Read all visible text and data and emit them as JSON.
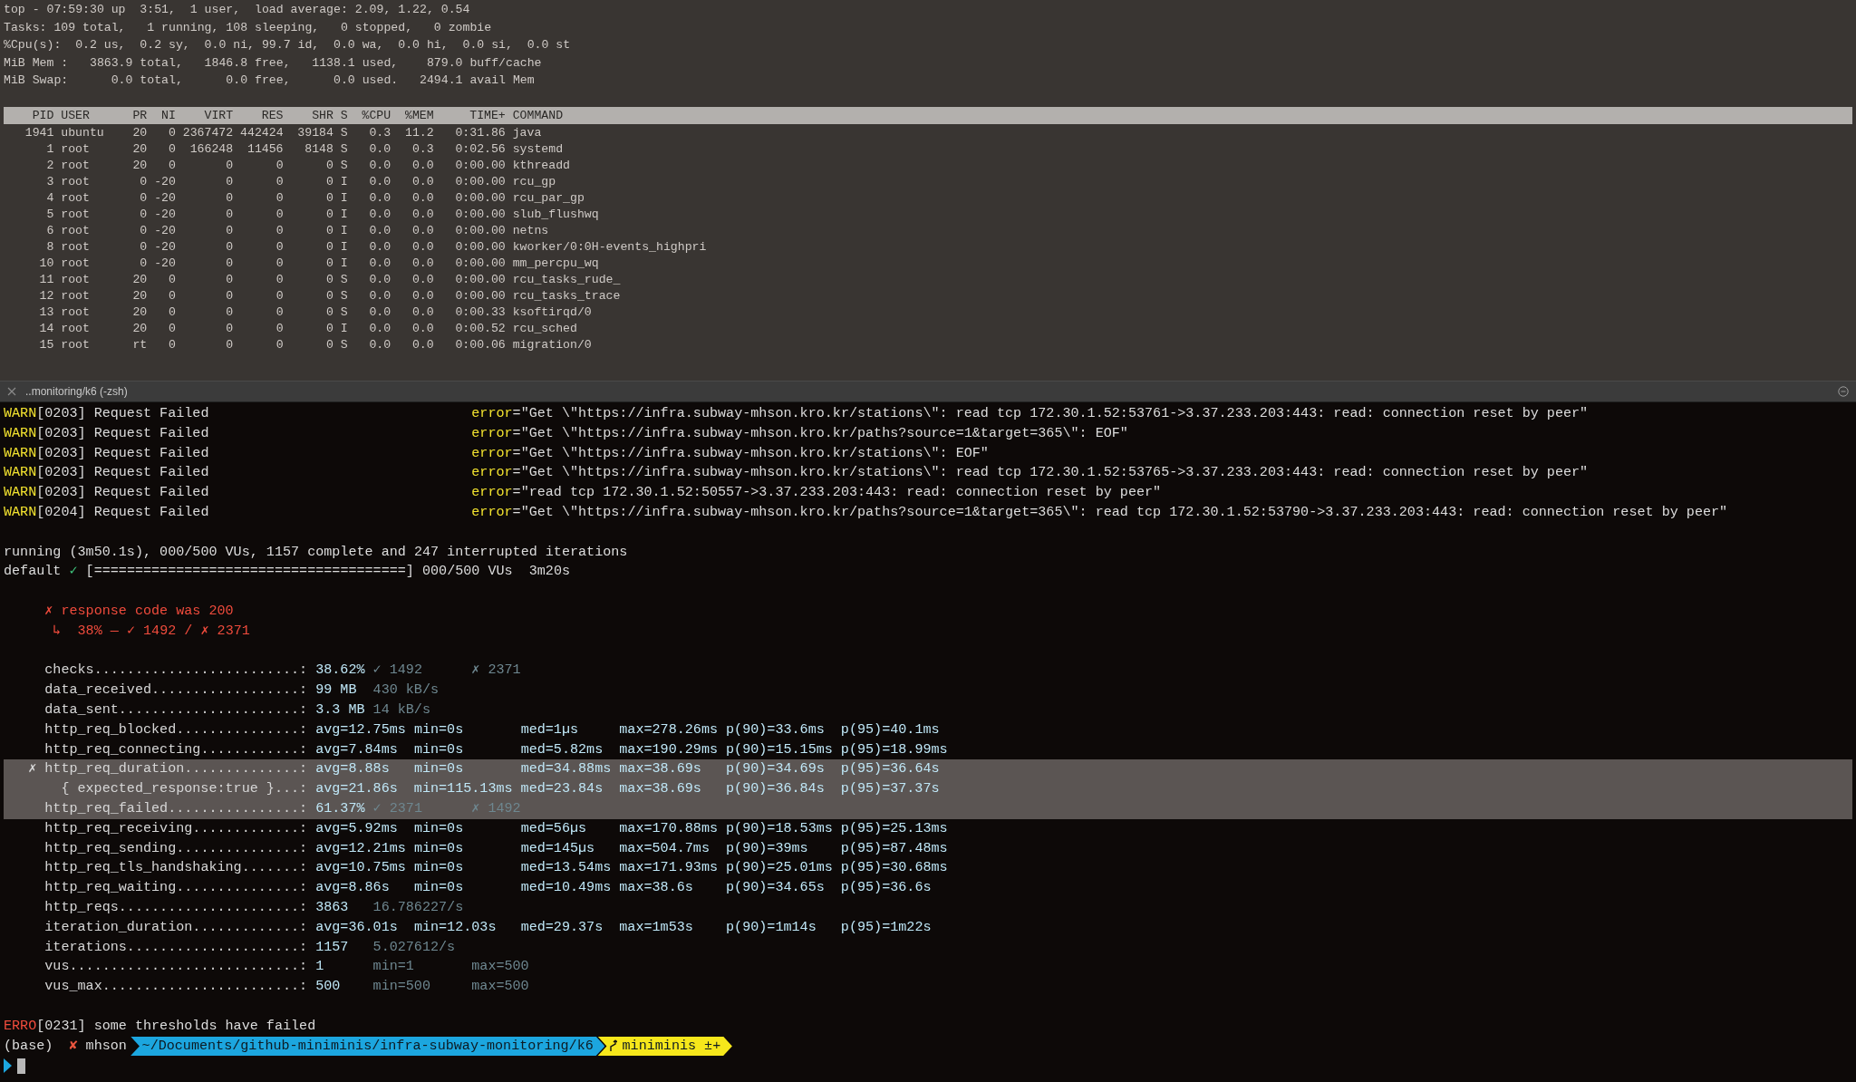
{
  "top": {
    "summary": [
      "top - 07:59:30 up  3:51,  1 user,  load average: 2.09, 1.22, 0.54",
      "Tasks: 109 total,   1 running, 108 sleeping,   0 stopped,   0 zombie",
      "%Cpu(s):  0.2 us,  0.2 sy,  0.0 ni, 99.7 id,  0.0 wa,  0.0 hi,  0.0 si,  0.0 st",
      "MiB Mem :   3863.9 total,   1846.8 free,   1138.1 used,    879.0 buff/cache",
      "MiB Swap:      0.0 total,      0.0 free,      0.0 used.   2494.1 avail Mem"
    ],
    "columns": [
      "PID",
      "USER",
      "PR",
      "NI",
      "VIRT",
      "RES",
      "SHR",
      "S",
      "%CPU",
      "%MEM",
      "TIME+",
      "COMMAND"
    ],
    "rows": [
      [
        "1941",
        "ubuntu",
        "20",
        "0",
        "2367472",
        "442424",
        "39184",
        "S",
        "0.3",
        "11.2",
        "0:31.86",
        "java"
      ],
      [
        "1",
        "root",
        "20",
        "0",
        "166248",
        "11456",
        "8148",
        "S",
        "0.0",
        "0.3",
        "0:02.56",
        "systemd"
      ],
      [
        "2",
        "root",
        "20",
        "0",
        "0",
        "0",
        "0",
        "S",
        "0.0",
        "0.0",
        "0:00.00",
        "kthreadd"
      ],
      [
        "3",
        "root",
        "0",
        "-20",
        "0",
        "0",
        "0",
        "I",
        "0.0",
        "0.0",
        "0:00.00",
        "rcu_gp"
      ],
      [
        "4",
        "root",
        "0",
        "-20",
        "0",
        "0",
        "0",
        "I",
        "0.0",
        "0.0",
        "0:00.00",
        "rcu_par_gp"
      ],
      [
        "5",
        "root",
        "0",
        "-20",
        "0",
        "0",
        "0",
        "I",
        "0.0",
        "0.0",
        "0:00.00",
        "slub_flushwq"
      ],
      [
        "6",
        "root",
        "0",
        "-20",
        "0",
        "0",
        "0",
        "I",
        "0.0",
        "0.0",
        "0:00.00",
        "netns"
      ],
      [
        "8",
        "root",
        "0",
        "-20",
        "0",
        "0",
        "0",
        "I",
        "0.0",
        "0.0",
        "0:00.00",
        "kworker/0:0H-events_highpri"
      ],
      [
        "10",
        "root",
        "0",
        "-20",
        "0",
        "0",
        "0",
        "I",
        "0.0",
        "0.0",
        "0:00.00",
        "mm_percpu_wq"
      ],
      [
        "11",
        "root",
        "20",
        "0",
        "0",
        "0",
        "0",
        "S",
        "0.0",
        "0.0",
        "0:00.00",
        "rcu_tasks_rude_"
      ],
      [
        "12",
        "root",
        "20",
        "0",
        "0",
        "0",
        "0",
        "S",
        "0.0",
        "0.0",
        "0:00.00",
        "rcu_tasks_trace"
      ],
      [
        "13",
        "root",
        "20",
        "0",
        "0",
        "0",
        "0",
        "S",
        "0.0",
        "0.0",
        "0:00.33",
        "ksoftirqd/0"
      ],
      [
        "14",
        "root",
        "20",
        "0",
        "0",
        "0",
        "0",
        "I",
        "0.0",
        "0.0",
        "0:00.52",
        "rcu_sched"
      ],
      [
        "15",
        "root",
        "rt",
        "0",
        "0",
        "0",
        "0",
        "S",
        "0.0",
        "0.0",
        "0:00.06",
        "migration/0"
      ]
    ]
  },
  "pane_tab": {
    "title": "..monitoring/k6 (-zsh)"
  },
  "logs": [
    {
      "kind": "warn",
      "level": "WARN",
      "message": "[0203] Request Failed",
      "field": "error",
      "value": "=\"Get \\\"https://infra.subway-mhson.kro.kr/stations\\\": read tcp 172.30.1.52:53761->3.37.233.203:443: read: connection reset by peer\""
    },
    {
      "kind": "warn",
      "level": "WARN",
      "message": "[0203] Request Failed",
      "field": "error",
      "value": "=\"Get \\\"https://infra.subway-mhson.kro.kr/paths?source=1&target=365\\\": EOF\""
    },
    {
      "kind": "warn",
      "level": "WARN",
      "message": "[0203] Request Failed",
      "field": "error",
      "value": "=\"Get \\\"https://infra.subway-mhson.kro.kr/stations\\\": EOF\""
    },
    {
      "kind": "warn",
      "level": "WARN",
      "message": "[0203] Request Failed",
      "field": "error",
      "value": "=\"Get \\\"https://infra.subway-mhson.kro.kr/stations\\\": read tcp 172.30.1.52:53765->3.37.233.203:443: read: connection reset by peer\""
    },
    {
      "kind": "warn",
      "level": "WARN",
      "message": "[0203] Request Failed",
      "field": "error",
      "value": "=\"read tcp 172.30.1.52:50557->3.37.233.203:443: read: connection reset by peer\""
    },
    {
      "kind": "warn",
      "level": "WARN",
      "message": "[0204] Request Failed",
      "field": "error",
      "value": "=\"Get \\\"https://infra.subway-mhson.kro.kr/paths?source=1&target=365\\\": read tcp 172.30.1.52:53790->3.37.233.203:443: read: connection reset by peer\""
    }
  ],
  "run_status": "running (3m50.1s), 000/500 VUs, 1157 complete and 247 interrupted iterations",
  "scenario": {
    "name": "default",
    "check": "✓",
    "bar": "[======================================]",
    "status": "000/500 VUs  3m20s"
  },
  "check_failures": [
    {
      "mark": "✗",
      "name": "response code was 200",
      "detail": "↳  38% — ✓ 1492 / ✗ 2371"
    }
  ],
  "metrics": [
    {
      "kind": "rate",
      "label": "checks.........................:",
      "highlighted": false,
      "values": [
        {
          "text": "38.62%",
          "muted": false
        },
        {
          "text": "✓ 1492",
          "muted": true
        },
        {
          "text": "✗ 2371",
          "muted": true
        }
      ]
    },
    {
      "kind": "counter",
      "label": "data_received..................:",
      "highlighted": false,
      "values": [
        {
          "text": "99 MB",
          "muted": false
        },
        {
          "text": "430 kB/s",
          "muted": true
        }
      ]
    },
    {
      "kind": "counter",
      "label": "data_sent......................:",
      "highlighted": false,
      "values": [
        {
          "text": "3.3 MB",
          "muted": false
        },
        {
          "text": "14 kB/s",
          "muted": true
        }
      ]
    },
    {
      "kind": "trend",
      "label": "http_req_blocked...............:",
      "highlighted": false,
      "values": [
        {
          "text": "avg=12.75ms",
          "muted": false
        },
        {
          "text": "min=0s",
          "muted": false
        },
        {
          "text": "med=1µs",
          "muted": false
        },
        {
          "text": "max=278.26ms",
          "muted": false
        },
        {
          "text": "p(90)=33.6ms",
          "muted": false
        },
        {
          "text": "p(95)=40.1ms",
          "muted": false
        }
      ]
    },
    {
      "kind": "trend",
      "label": "http_req_connecting............:",
      "highlighted": false,
      "values": [
        {
          "text": "avg=7.84ms",
          "muted": false
        },
        {
          "text": "min=0s",
          "muted": false
        },
        {
          "text": "med=5.82ms",
          "muted": false
        },
        {
          "text": "max=190.29ms",
          "muted": false
        },
        {
          "text": "p(90)=15.15ms",
          "muted": false
        },
        {
          "text": "p(95)=18.99ms",
          "muted": false
        }
      ]
    },
    {
      "kind": "trend",
      "mark": "✗",
      "label": "http_req_duration..............:",
      "highlighted": true,
      "values": [
        {
          "text": "avg=8.88s",
          "muted": false
        },
        {
          "text": "min=0s",
          "muted": false
        },
        {
          "text": "med=34.88ms",
          "muted": false
        },
        {
          "text": "max=38.69s",
          "muted": false
        },
        {
          "text": "p(90)=34.69s",
          "muted": false
        },
        {
          "text": "p(95)=36.64s",
          "muted": false
        }
      ],
      "children": [
        {
          "kind": "trend",
          "label": "{ expected_response:true }...:",
          "highlighted": true,
          "values": [
            {
              "text": "avg=21.86s",
              "muted": false
            },
            {
              "text": "min=115.13ms",
              "muted": false
            },
            {
              "text": "med=23.84s",
              "muted": false
            },
            {
              "text": "max=38.69s",
              "muted": false
            },
            {
              "text": "p(90)=36.84s",
              "muted": false
            },
            {
              "text": "p(95)=37.37s",
              "muted": false
            }
          ]
        }
      ]
    },
    {
      "kind": "rate",
      "label": "http_req_failed................:",
      "highlighted": true,
      "values": [
        {
          "text": "61.37%",
          "muted": false
        },
        {
          "text": "✓ 2371",
          "muted": true
        },
        {
          "text": "✗ 1492",
          "muted": true
        }
      ]
    },
    {
      "kind": "trend",
      "label": "http_req_receiving.............:",
      "highlighted": false,
      "values": [
        {
          "text": "avg=5.92ms",
          "muted": false
        },
        {
          "text": "min=0s",
          "muted": false
        },
        {
          "text": "med=56µs",
          "muted": false
        },
        {
          "text": "max=170.88ms",
          "muted": false
        },
        {
          "text": "p(90)=18.53ms",
          "muted": false
        },
        {
          "text": "p(95)=25.13ms",
          "muted": false
        }
      ]
    },
    {
      "kind": "trend",
      "label": "http_req_sending...............:",
      "highlighted": false,
      "values": [
        {
          "text": "avg=12.21ms",
          "muted": false
        },
        {
          "text": "min=0s",
          "muted": false
        },
        {
          "text": "med=145µs",
          "muted": false
        },
        {
          "text": "max=504.7ms",
          "muted": false
        },
        {
          "text": "p(90)=39ms",
          "muted": false
        },
        {
          "text": "p(95)=87.48ms",
          "muted": false
        }
      ]
    },
    {
      "kind": "trend",
      "label": "http_req_tls_handshaking.......:",
      "highlighted": false,
      "values": [
        {
          "text": "avg=10.75ms",
          "muted": false
        },
        {
          "text": "min=0s",
          "muted": false
        },
        {
          "text": "med=13.54ms",
          "muted": false
        },
        {
          "text": "max=171.93ms",
          "muted": false
        },
        {
          "text": "p(90)=25.01ms",
          "muted": false
        },
        {
          "text": "p(95)=30.68ms",
          "muted": false
        }
      ]
    },
    {
      "kind": "trend",
      "label": "http_req_waiting...............:",
      "highlighted": false,
      "values": [
        {
          "text": "avg=8.86s",
          "muted": false
        },
        {
          "text": "min=0s",
          "muted": false
        },
        {
          "text": "med=10.49ms",
          "muted": false
        },
        {
          "text": "max=38.6s",
          "muted": false
        },
        {
          "text": "p(90)=34.65s",
          "muted": false
        },
        {
          "text": "p(95)=36.6s",
          "muted": false
        }
      ]
    },
    {
      "kind": "counter",
      "label": "http_reqs......................:",
      "highlighted": false,
      "values": [
        {
          "text": "3863",
          "muted": false
        },
        {
          "text": "16.786227/s",
          "muted": true
        }
      ]
    },
    {
      "kind": "trend",
      "label": "iteration_duration.............:",
      "highlighted": false,
      "values": [
        {
          "text": "avg=36.01s",
          "muted": false
        },
        {
          "text": "min=12.03s",
          "muted": false
        },
        {
          "text": "med=29.37s",
          "muted": false
        },
        {
          "text": "max=1m53s",
          "muted": false
        },
        {
          "text": "p(90)=1m14s",
          "muted": false
        },
        {
          "text": "p(95)=1m22s",
          "muted": false
        }
      ]
    },
    {
      "kind": "counter",
      "label": "iterations.....................:",
      "highlighted": false,
      "values": [
        {
          "text": "1157",
          "muted": false
        },
        {
          "text": "5.027612/s",
          "muted": true
        }
      ]
    },
    {
      "kind": "gauge",
      "label": "vus............................:",
      "highlighted": false,
      "values": [
        {
          "text": "1",
          "muted": false
        },
        {
          "text": "min=1",
          "muted": true
        },
        {
          "text": "max=500",
          "muted": true
        }
      ]
    },
    {
      "kind": "gauge",
      "label": "vus_max........................:",
      "highlighted": false,
      "values": [
        {
          "text": "500",
          "muted": false
        },
        {
          "text": "min=500",
          "muted": true
        },
        {
          "text": "max=500",
          "muted": true
        }
      ]
    }
  ],
  "final_log": {
    "kind": "error",
    "level": "ERRO",
    "message": "[0231] some thresholds have failed"
  },
  "prompt": {
    "env": "(base)",
    "status": "✘",
    "user": "mhson",
    "path": "~/Documents/github-miniminis/infra-subway-monitoring/k6",
    "branch": "miniminis ±+"
  }
}
